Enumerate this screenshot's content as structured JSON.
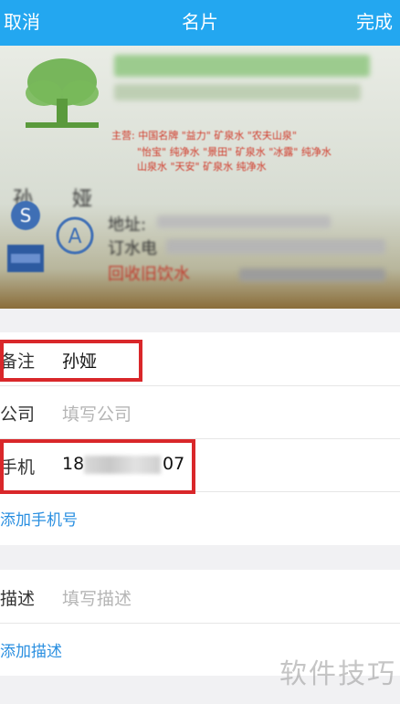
{
  "nav": {
    "cancel": "取消",
    "title": "名片",
    "done": "完成"
  },
  "card": {
    "person": "孙 娅",
    "line1": "主营: 中国名牌 \"益力\" 矿泉水  \"农夫山泉\"",
    "line2": "\"怡宝\" 纯净水  \"景田\" 矿泉水  \"冰露\" 纯净水",
    "line3": "山泉水  \"天安\" 矿泉水  纯净水",
    "addr": "地址:",
    "phone_label": "订水电",
    "recycle": "回收旧饮水"
  },
  "form": {
    "remark": {
      "label": "备注",
      "value": "孙娅"
    },
    "company": {
      "label": "公司",
      "placeholder": "填写公司"
    },
    "phone": {
      "label": "手机",
      "value_start": "18",
      "value_end": "07"
    },
    "add_phone": "添加手机号",
    "desc": {
      "label": "描述",
      "placeholder": "填写描述"
    },
    "add_desc": "添加描述"
  },
  "watermark": "软件技巧",
  "colors": {
    "nav": "#23a7f0",
    "highlight": "#d9272a",
    "link": "#2a8fe0"
  }
}
